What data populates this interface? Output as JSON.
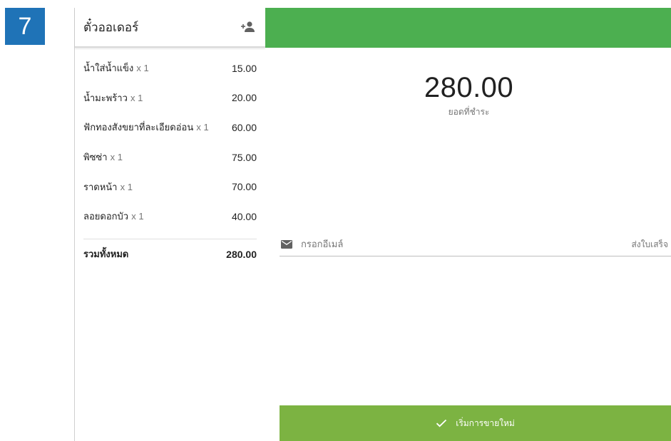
{
  "step": "7",
  "order": {
    "title": "ตั๋วออเดอร์",
    "items": [
      {
        "name": "น้ำใส่น้ำแข็ง",
        "qty": "x 1",
        "price": "15.00"
      },
      {
        "name": "น้ำมะพร้าว",
        "qty": "x 1",
        "price": "20.00"
      },
      {
        "name": "ฟักทองสังขยาที่ละเอียดอ่อน",
        "qty": "x 1",
        "price": "60.00"
      },
      {
        "name": "พิซซ่า",
        "qty": "x 1",
        "price": "75.00"
      },
      {
        "name": "ราดหน้า",
        "qty": "x 1",
        "price": "70.00"
      },
      {
        "name": "ลอยดอกบัว",
        "qty": "x 1",
        "price": "40.00"
      }
    ],
    "total_label": "รวมทั้งหมด",
    "total_value": "280.00"
  },
  "payment": {
    "amount": "280.00",
    "amount_label": "ยอดที่ชำระ",
    "email_placeholder": "กรอกอีเมล์",
    "send_receipt": "ส่งใบเสร็จ",
    "new_sale_label": "เริ่มการขายใหม่"
  },
  "colors": {
    "step_badge": "#1f73b7",
    "header_green": "#4caf50",
    "button_green": "#7cb342"
  },
  "icons": {
    "header": "add-customer-icon",
    "email": "mail-icon",
    "button": "check-icon"
  }
}
